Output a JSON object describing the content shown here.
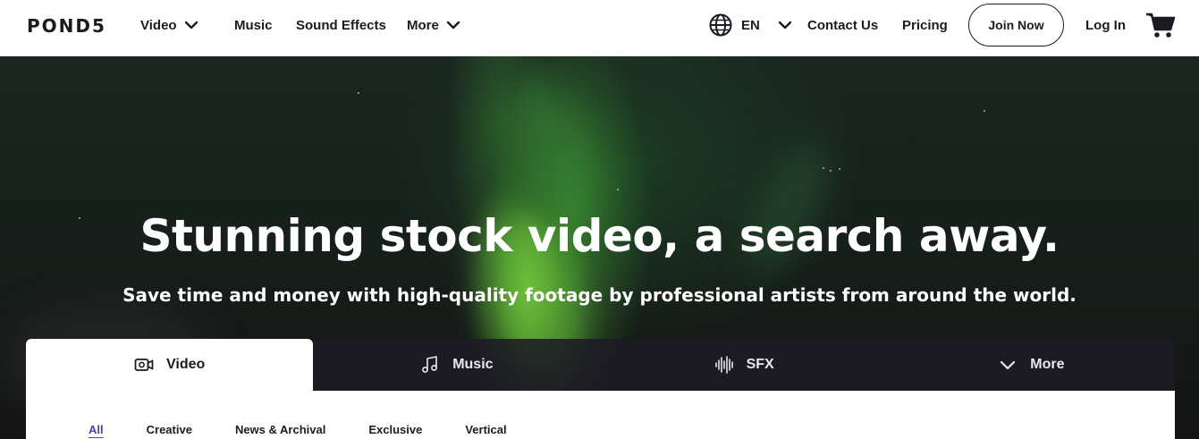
{
  "header": {
    "logo": "POND5",
    "nav": {
      "video": "Video",
      "music": "Music",
      "sound_effects": "Sound Effects",
      "more": "More"
    },
    "language": "EN",
    "contact": "Contact Us",
    "pricing": "Pricing",
    "join": "Join Now",
    "login": "Log In"
  },
  "hero": {
    "title": "Stunning stock video, a search away.",
    "subtitle": "Save time and money with high-quality footage by professional artists from around the world."
  },
  "search_tabs": [
    {
      "label": "Video",
      "icon": "video-camera-icon",
      "active": true
    },
    {
      "label": "Music",
      "icon": "music-note-icon",
      "active": false
    },
    {
      "label": "SFX",
      "icon": "waveform-icon",
      "active": false
    },
    {
      "label": "More",
      "icon": "chevron-down-icon",
      "active": false
    }
  ],
  "subtabs": [
    "All",
    "Creative",
    "News & Archival",
    "Exclusive",
    "Vertical"
  ],
  "colors": {
    "accent": "#4a3fb5",
    "text": "#1c1b22"
  }
}
